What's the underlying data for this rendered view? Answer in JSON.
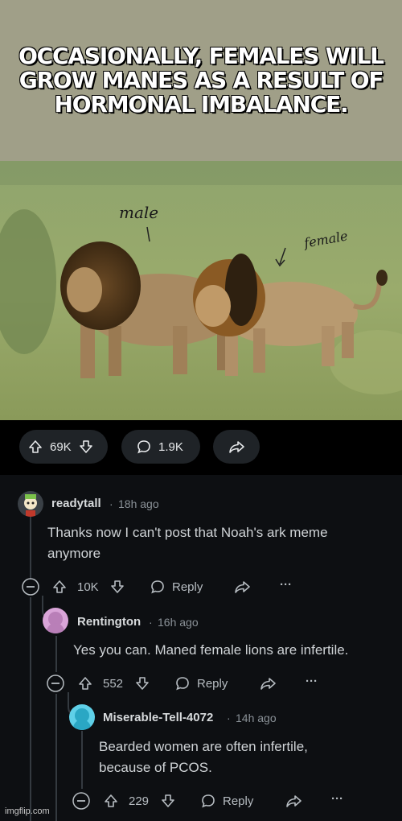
{
  "caption": {
    "text": "OCCASIONALLY, FEMALES WILL GROW MANES AS A RESULT OF HORMONAL IMBALANCE."
  },
  "photo": {
    "annotation_male": "male",
    "annotation_female": "female"
  },
  "post_actions": {
    "upvotes": "69K",
    "comments": "1.9K"
  },
  "comments": [
    {
      "user": "readytall",
      "ago": "18h ago",
      "body_line1": "Thanks now I can't post that Noah's ark meme",
      "body_line2": "anymore",
      "votes": "10K",
      "reply_label": "Reply",
      "more": "···"
    },
    {
      "user": "Rentington",
      "ago": "16h ago",
      "body_line1": "Yes you can. Maned female lions are infertile.",
      "votes": "552",
      "reply_label": "Reply",
      "more": "···"
    },
    {
      "user": "Miserable-Tell-4072",
      "ago": "14h ago",
      "body_line1": "Bearded women are often infertile,",
      "body_line2": "because of PCOS.",
      "votes": "229",
      "reply_label": "Reply",
      "more": "···"
    }
  ],
  "separator": "·",
  "watermark": "imgflip.com",
  "colors": {
    "caption_bg": "#a09f88",
    "dark_bg": "#0d0f12",
    "pill_bg": "#1f2327",
    "text": "#cfd3d6"
  }
}
